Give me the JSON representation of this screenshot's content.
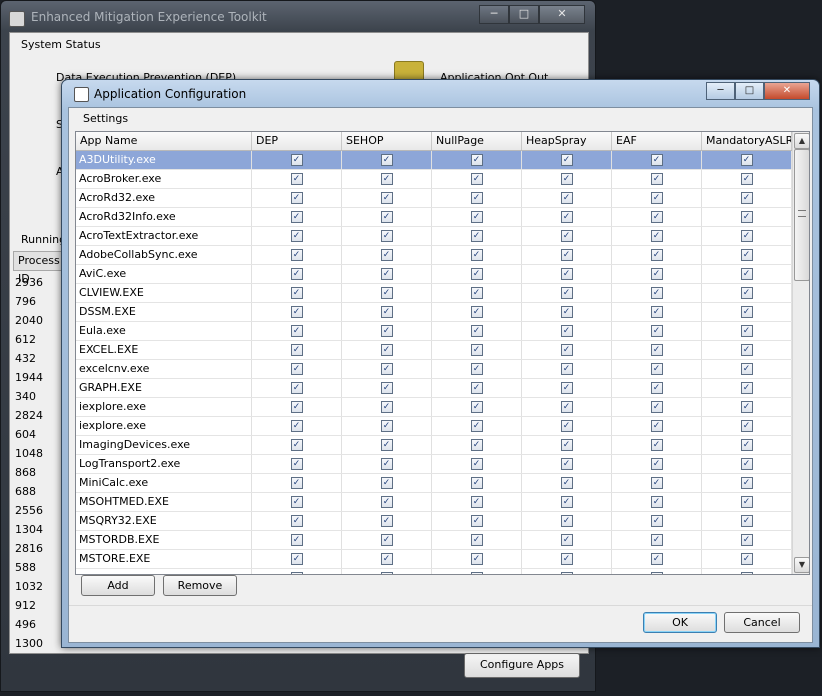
{
  "background_window": {
    "title": "Enhanced Mitigation Experience Toolkit",
    "system_status_tab": "System Status",
    "dep_label": "Data Execution Prevention (DEP)",
    "dep_value": "Application Opt Out",
    "fragment_1": "St",
    "fragment_2": "Ad",
    "running_label": "Running",
    "pid_header": "Process ID",
    "process_ids": [
      "2936",
      "796",
      "2040",
      "612",
      "432",
      "1944",
      "340",
      "2824",
      "604",
      "1048",
      "868",
      "688",
      "2556",
      "1304",
      "2816",
      "588",
      "1032",
      "912",
      "496",
      "1300"
    ],
    "configure_apps_button": "Configure Apps",
    "caption_minimize": "─",
    "caption_maximize": "□",
    "caption_close": "✕"
  },
  "dialog": {
    "title": "Application Configuration",
    "settings_tab": "Settings",
    "columns": [
      "App Name",
      "DEP",
      "SEHOP",
      "NullPage",
      "HeapSpray",
      "EAF",
      "MandatoryASLR"
    ],
    "check_mark": "✓",
    "rows": [
      {
        "name": "A3DUtility.exe",
        "selected": true
      },
      {
        "name": "AcroBroker.exe"
      },
      {
        "name": "AcroRd32.exe"
      },
      {
        "name": "AcroRd32Info.exe"
      },
      {
        "name": "AcroTextExtractor.exe"
      },
      {
        "name": "AdobeCollabSync.exe"
      },
      {
        "name": "AviC.exe"
      },
      {
        "name": "CLVIEW.EXE"
      },
      {
        "name": "DSSM.EXE"
      },
      {
        "name": "Eula.exe"
      },
      {
        "name": "EXCEL.EXE"
      },
      {
        "name": "excelcnv.exe"
      },
      {
        "name": "GRAPH.EXE"
      },
      {
        "name": "iexplore.exe"
      },
      {
        "name": "iexplore.exe"
      },
      {
        "name": "ImagingDevices.exe"
      },
      {
        "name": "LogTransport2.exe"
      },
      {
        "name": "MiniCalc.exe"
      },
      {
        "name": "MSOHTMED.EXE"
      },
      {
        "name": "MSQRY32.EXE"
      },
      {
        "name": "MSTORDB.EXE"
      },
      {
        "name": "MSTORE.EXE"
      },
      {
        "name": ""
      }
    ],
    "add_button": "Add",
    "remove_button": "Remove",
    "ok_button": "OK",
    "cancel_button": "Cancel",
    "caption_minimize": "─",
    "caption_maximize": "□",
    "caption_close": "✕",
    "scroll_up": "▲",
    "scroll_down": "▼"
  }
}
